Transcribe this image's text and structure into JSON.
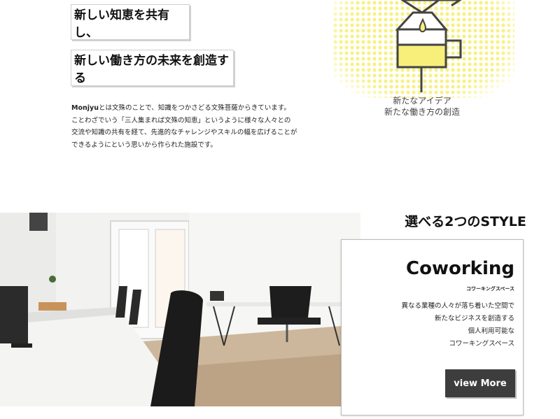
{
  "hero": {
    "line1": "新しい知恵を共有し、",
    "line2": "新しい働き方の未来を創造する"
  },
  "intro": {
    "brand": "Monjyu",
    "line1_rest": "とは文殊のことで、知識をつかさどる文殊菩薩からきています。",
    "line2": "ことわざでいう「三人集まれば文殊の知恵」というように様々な人々との",
    "line3": "交流や知識の共有を経て、先進的なチャレンジやスキルの幅を広げることが",
    "line4": "できるようにという思いから作られた施設です。"
  },
  "illustration": {
    "caption1": "新たなアイデア",
    "caption2": "新たな働き方の創造",
    "icon": "coffee-dripper-icon",
    "accent_color": "#f7ef7a"
  },
  "style_section": {
    "title": "選べる2つのSTYLE",
    "card": {
      "title": "Coworking",
      "subtitle": "コワーキングスペース",
      "lines": [
        "異なる業種の人々が落ち着いた空間で",
        "新たなビジネスを創造する",
        "個人利用可能な",
        "コワーキングスペース"
      ],
      "button_label": "view More",
      "button_color": "#3d3d3d"
    }
  }
}
